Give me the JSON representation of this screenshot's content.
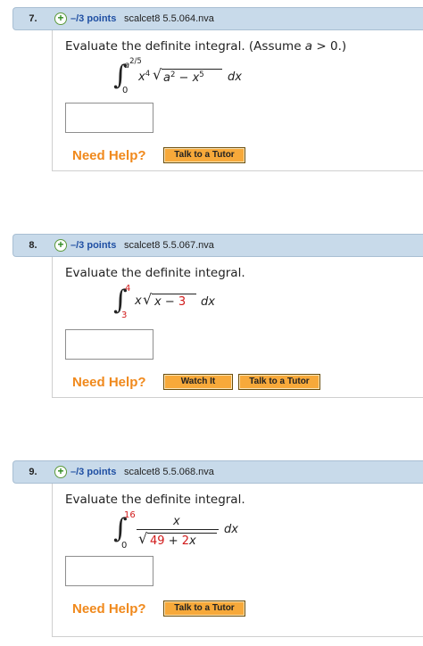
{
  "questions": [
    {
      "number": "7.",
      "points": "–/3 points",
      "code": "scalcet8 5.5.064.nva",
      "prompt_pre": "Evaluate the definite integral. (Assume",
      "prompt_var": "a",
      "prompt_post": "> 0.)",
      "integral": {
        "lower": "0",
        "upper": "a",
        "upper_exp": "2/5",
        "factor": "x",
        "factor_exp": "4",
        "radicand_a": "a",
        "radicand_a_exp": "2",
        "radicand_minus": "−",
        "radicand_x": "x",
        "radicand_x_exp": "5",
        "dx": "dx"
      },
      "help_label": "Need Help?",
      "buttons": [
        "Talk to a Tutor"
      ]
    },
    {
      "number": "8.",
      "points": "–/3 points",
      "code": "scalcet8 5.5.067.nva",
      "prompt": "Evaluate the definite integral.",
      "integral": {
        "lower": "3",
        "upper": "4",
        "factor": "x",
        "radicand_x": "x",
        "radicand_minus": "−",
        "radicand_c": "3",
        "dx": "dx"
      },
      "help_label": "Need Help?",
      "buttons": [
        "Watch It",
        "Talk to a Tutor"
      ]
    },
    {
      "number": "9.",
      "points": "–/3 points",
      "code": "scalcet8 5.5.068.nva",
      "prompt": "Evaluate the definite integral.",
      "integral": {
        "lower": "0",
        "upper": "16",
        "numerator": "x",
        "den_const": "49",
        "den_plus": "+",
        "den_coef": "2",
        "den_var": "x",
        "dx": "dx"
      },
      "help_label": "Need Help?",
      "buttons": [
        "Talk to a Tutor"
      ]
    }
  ],
  "colors": {
    "header_bg": "#c8daea",
    "points_blue": "#1f4fa3",
    "help_orange": "#f0891c",
    "button_orange": "#f7a93a",
    "limit_red": "#d11a1a",
    "plus_green": "#2e8a1e"
  },
  "icons": [
    "plus-circle-icon"
  ]
}
